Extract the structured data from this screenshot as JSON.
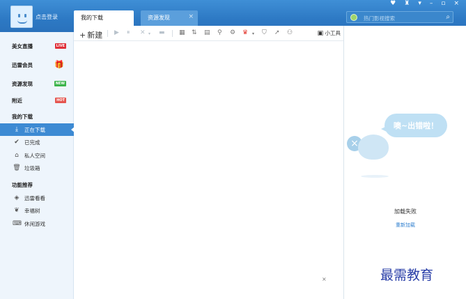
{
  "header": {
    "login_label": "点击登录",
    "tabs": [
      {
        "label": "我的下载",
        "active": true
      },
      {
        "label": "资源发现",
        "active": false,
        "close": "×"
      }
    ],
    "search_placeholder": "热门影视搜索",
    "window_controls": [
      "♥",
      "♜",
      "▾",
      "–",
      "▫",
      "×"
    ]
  },
  "sidebar": {
    "top_items": [
      {
        "label": "美女直播",
        "badge": "LIVE"
      },
      {
        "label": "迅雷会员",
        "badge_icon": "gift-icon"
      },
      {
        "label": "资源发现",
        "badge": "NEW"
      },
      {
        "label": "附近",
        "badge": "HOT"
      }
    ],
    "downloads_heading": "我的下载",
    "download_items": [
      {
        "label": "正在下载",
        "icon": "download-icon",
        "active": true
      },
      {
        "label": "已完成",
        "icon": "check-icon",
        "active": false
      },
      {
        "label": "私人空间",
        "icon": "lock-icon",
        "active": false
      },
      {
        "label": "垃圾箱",
        "icon": "trash-icon",
        "active": false
      }
    ],
    "features_heading": "功能推荐",
    "feature_items": [
      {
        "label": "迅雷看看",
        "icon": "play-shield-icon"
      },
      {
        "label": "幸福树",
        "icon": "leaf-icon"
      },
      {
        "label": "休闲游戏",
        "icon": "gamepad-icon"
      }
    ]
  },
  "toolbar": {
    "new_label": "新建",
    "new_symbol": "+",
    "tools_label": "小工具"
  },
  "main": {
    "close_symbol": "×"
  },
  "right_panel": {
    "bubble_text": "噢~出错啦！",
    "load_fail": "加载失败",
    "reload": "重新加载"
  },
  "watermark": "最需教育",
  "colors": {
    "titlebar": "#2d79c4",
    "sidebar_bg": "#eef5fc",
    "active_item": "#3d8ad3",
    "link": "#2f7fcf"
  }
}
